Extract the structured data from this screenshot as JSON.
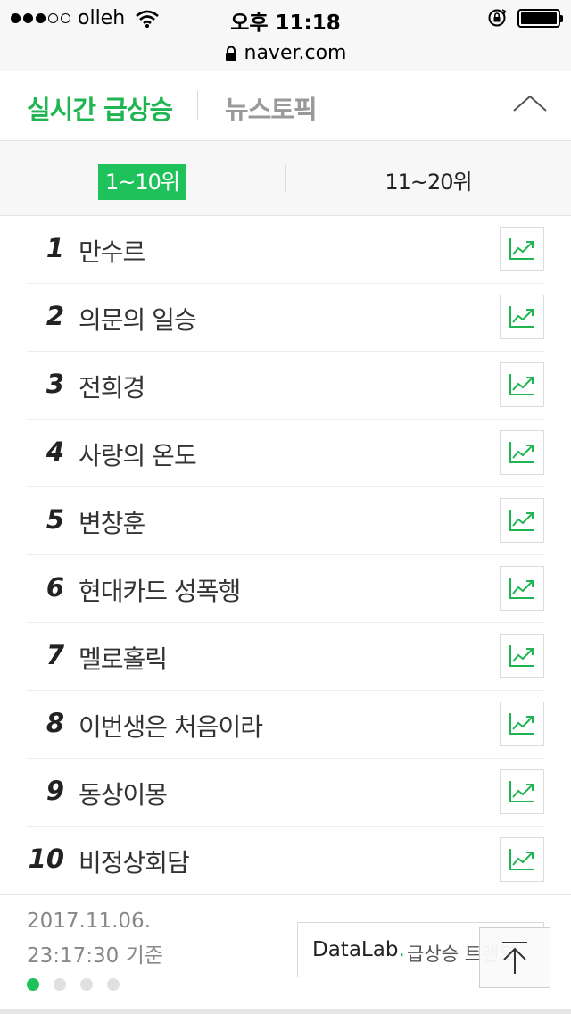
{
  "status_bar": {
    "carrier": "olleh",
    "time": "오후 11:18",
    "signal_dots_filled": 3,
    "signal_dots_total": 5
  },
  "browser": {
    "url": "naver.com"
  },
  "header": {
    "tab_realtime": "실시간 급상승",
    "tab_news": "뉴스토픽"
  },
  "range_tabs": {
    "first": "1~10위",
    "second": "11~20위"
  },
  "rankings": [
    {
      "rank": "1",
      "keyword": "만수르"
    },
    {
      "rank": "2",
      "keyword": "의문의 일승"
    },
    {
      "rank": "3",
      "keyword": "전희경"
    },
    {
      "rank": "4",
      "keyword": "사랑의 온도"
    },
    {
      "rank": "5",
      "keyword": "변창훈"
    },
    {
      "rank": "6",
      "keyword": "현대카드 성폭행"
    },
    {
      "rank": "7",
      "keyword": "멜로홀릭"
    },
    {
      "rank": "8",
      "keyword": "이번생은 처음이라"
    },
    {
      "rank": "9",
      "keyword": "동상이몽"
    },
    {
      "rank": "10",
      "keyword": "비정상회담"
    }
  ],
  "footer": {
    "date": "2017.11.06.",
    "time": "23:17:30 기준",
    "datalab_brand": "DataLab",
    "datalab_dot": ".",
    "datalab_text": "급상승 트렌드",
    "page_count": 4,
    "active_page": 1
  },
  "colors": {
    "accent": "#1fc15a",
    "accent_text": "#1fb652"
  },
  "icons": {
    "chart": "trend-chart-icon",
    "collapse": "chevron-up-icon",
    "top": "scroll-top-icon",
    "lock": "lock-icon",
    "wifi": "wifi-icon",
    "battery": "battery-icon",
    "rotation_lock": "rotation-lock-icon"
  }
}
